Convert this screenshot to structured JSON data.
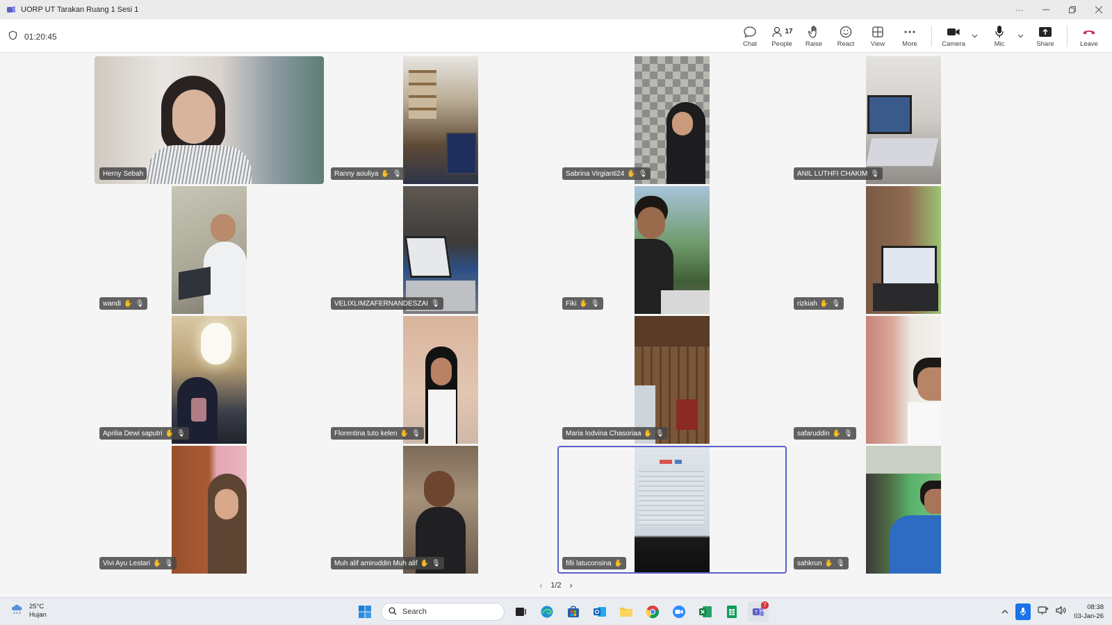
{
  "window": {
    "title": "UORP UT Tarakan Ruang 1 Sesi 1"
  },
  "meeting": {
    "elapsed": "01:20:45",
    "toolbar": {
      "chat": "Chat",
      "people": "People",
      "people_count": "17",
      "raise": "Raise",
      "react": "React",
      "view": "View",
      "more": "More",
      "camera": "Camera",
      "mic": "Mic",
      "share": "Share",
      "leave": "Leave"
    }
  },
  "participants": [
    {
      "name": "Herny Sebah"
    },
    {
      "name": "Ranny aouliya"
    },
    {
      "name": "Sabrina Virgianti24"
    },
    {
      "name": "ANIL LUTHFI CHAKIM"
    },
    {
      "name": "wandi"
    },
    {
      "name": "VELIXLIMZAFERNANDESZAI"
    },
    {
      "name": "Fiki"
    },
    {
      "name": "rizkiah"
    },
    {
      "name": "Aprilia Dewi saputri"
    },
    {
      "name": "Florentina tuto kelen"
    },
    {
      "name": "Maria Iodvina Chasoriaa"
    },
    {
      "name": "safaruddin"
    },
    {
      "name": "Vivi Ayu Lestari"
    },
    {
      "name": "Muh alif amiruddin Muh alif"
    },
    {
      "name": "fifii latuconsina"
    },
    {
      "name": "sahkrun"
    }
  ],
  "pager": {
    "label": "1/2"
  },
  "taskbar": {
    "weather_temp": "25°C",
    "weather_desc": "Hujan",
    "search_placeholder": "Search",
    "time": "08:38",
    "date": "03-Jan-26",
    "teams_badge": "7"
  },
  "colors": {
    "accent": "#5b5fc7",
    "leave": "#c4314b"
  }
}
